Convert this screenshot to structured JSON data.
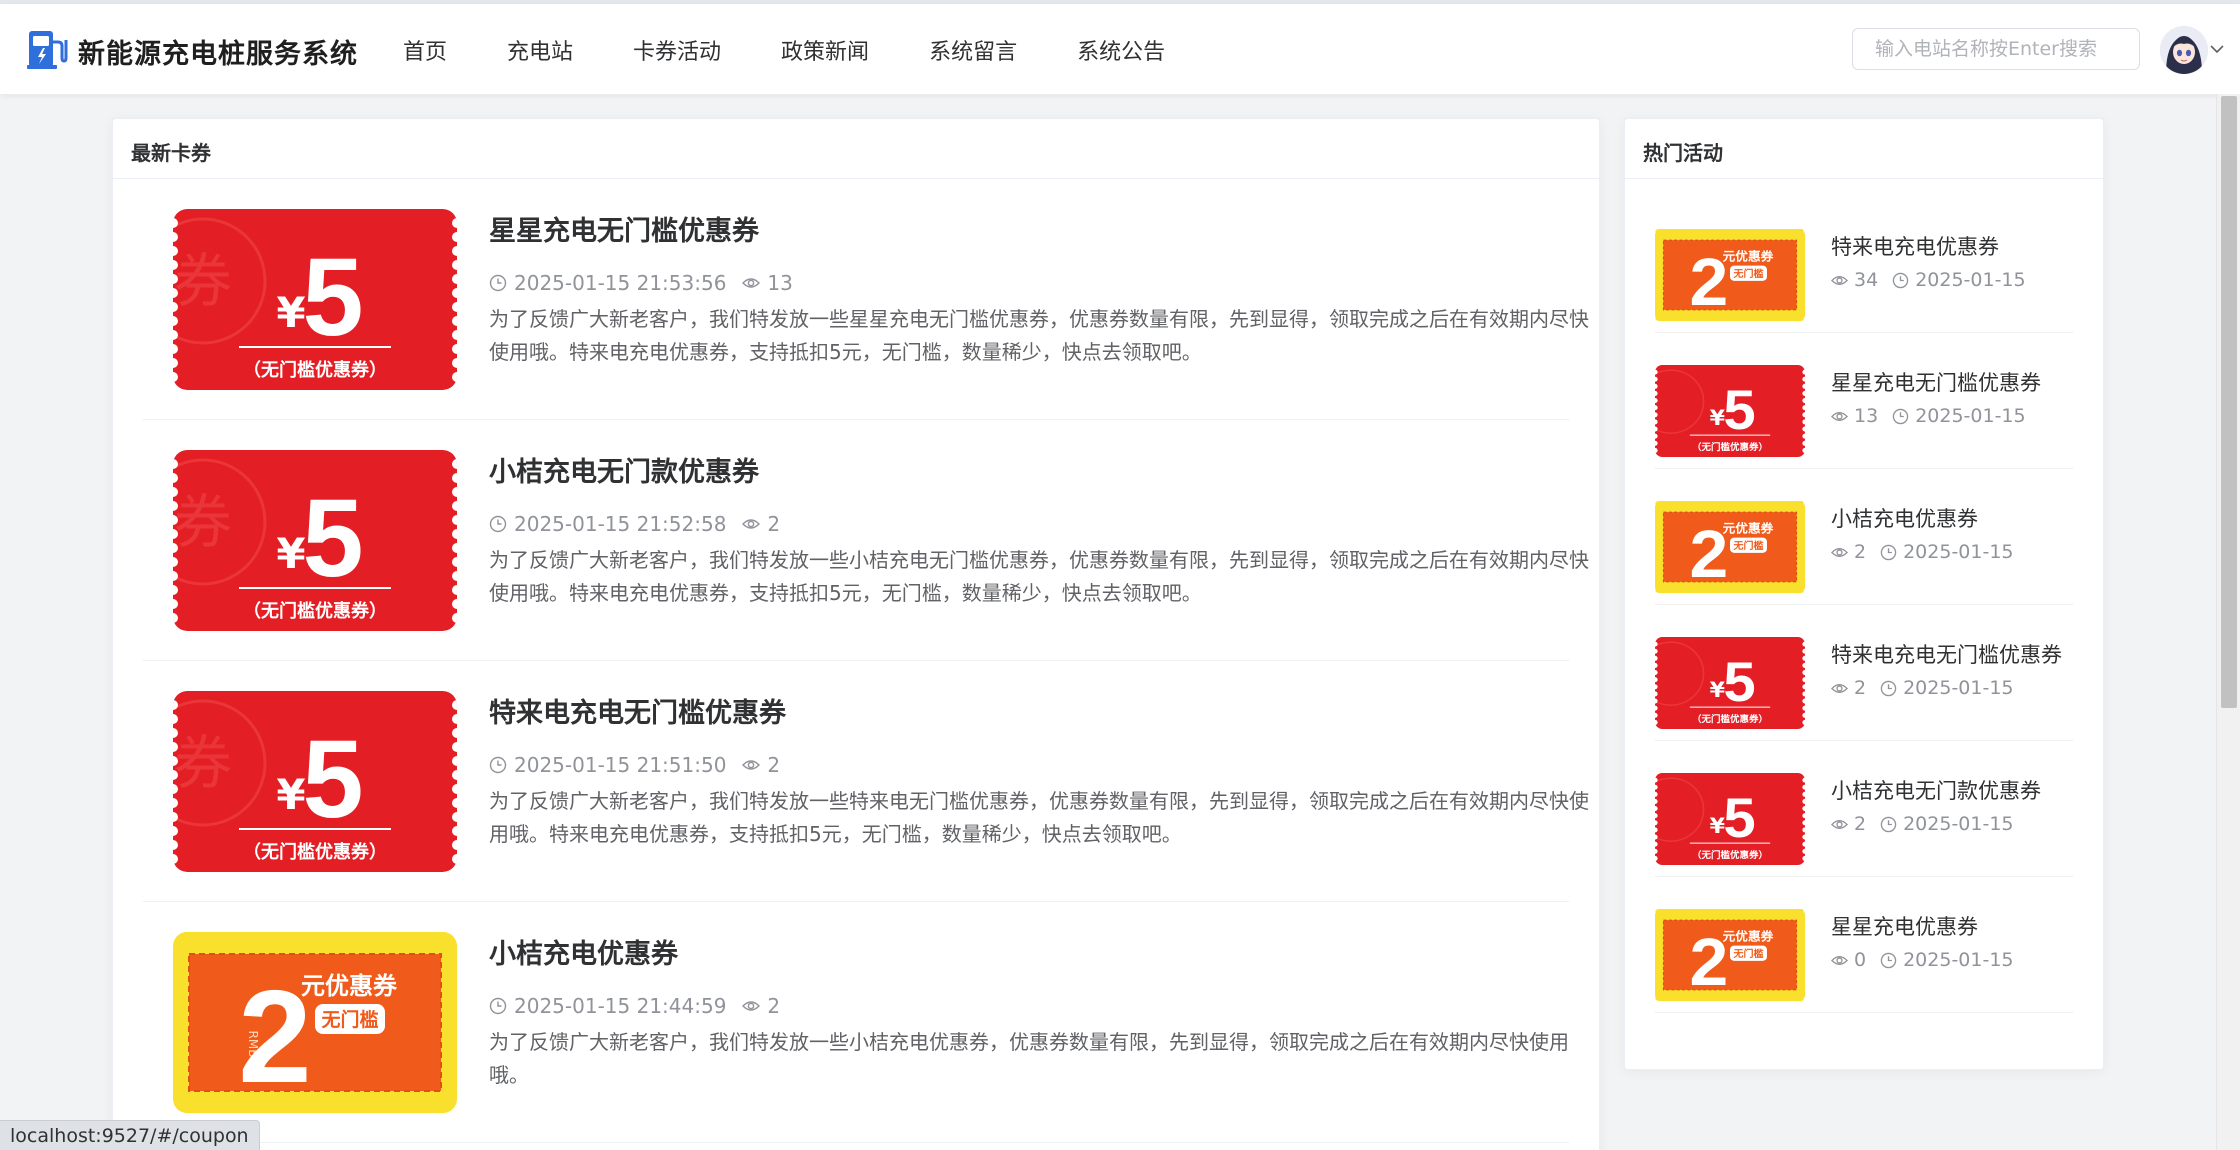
{
  "header": {
    "brand": "新能源充电桩服务系统",
    "nav": [
      "首页",
      "充电站",
      "卡券活动",
      "政策新闻",
      "系统留言",
      "系统公告"
    ],
    "search_placeholder": "输入电站名称按Enter搜索"
  },
  "main": {
    "title": "最新卡券",
    "coupons": [
      {
        "title": "星星充电无门槛优惠券",
        "datetime": "2025-01-15 21:53:56",
        "views": "13",
        "description": "为了反馈广大新老客户，我们特发放一些星星充电无门槛优惠券，优惠券数量有限，先到显得，领取完成之后在有效期内尽快使用哦。特来电充电优惠券，支持抵扣5元，无门槛，数量稀少，快点去领取吧。",
        "thumb": {
          "type": "red",
          "amount": "5",
          "currency": "¥",
          "caption": "（无门槛优惠券）",
          "watermark": "券"
        }
      },
      {
        "title": "小桔充电无门款优惠券",
        "datetime": "2025-01-15 21:52:58",
        "views": "2",
        "description": "为了反馈广大新老客户，我们特发放一些小桔充电无门槛优惠券，优惠券数量有限，先到显得，领取完成之后在有效期内尽快使用哦。特来电充电优惠券，支持抵扣5元，无门槛，数量稀少，快点去领取吧。",
        "thumb": {
          "type": "red",
          "amount": "5",
          "currency": "¥",
          "caption": "（无门槛优惠券）",
          "watermark": "券"
        }
      },
      {
        "title": "特来电充电无门槛优惠券",
        "datetime": "2025-01-15 21:51:50",
        "views": "2",
        "description": "为了反馈广大新老客户，我们特发放一些特来电无门槛优惠券，优惠券数量有限，先到显得，领取完成之后在有效期内尽快使用哦。特来电充电优惠券，支持抵扣5元，无门槛，数量稀少，快点去领取吧。",
        "thumb": {
          "type": "red",
          "amount": "5",
          "currency": "¥",
          "caption": "（无门槛优惠券）",
          "watermark": "券"
        }
      },
      {
        "title": "小桔充电优惠券",
        "datetime": "2025-01-15 21:44:59",
        "views": "2",
        "description": "为了反馈广大新老客户，我们特发放一些小桔充电优惠券，优惠券数量有限，先到显得，领取完成之后在有效期内尽快使用哦。",
        "thumb": {
          "type": "yellow",
          "amount": "2",
          "label": "元优惠券",
          "badge": "无门槛",
          "rmb": "RMB"
        }
      }
    ]
  },
  "side": {
    "title": "热门活动",
    "items": [
      {
        "title": "特来电充电优惠券",
        "views": "34",
        "date": "2025-01-15",
        "thumb": {
          "type": "yellow",
          "amount": "2",
          "label": "元优惠券",
          "badge": "无门槛"
        }
      },
      {
        "title": "星星充电无门槛优惠券",
        "views": "13",
        "date": "2025-01-15",
        "thumb": {
          "type": "red",
          "amount": "5",
          "currency": "¥",
          "caption": "（无门槛优惠券）"
        }
      },
      {
        "title": "小桔充电优惠券",
        "views": "2",
        "date": "2025-01-15",
        "thumb": {
          "type": "yellow",
          "amount": "2",
          "label": "元优惠券",
          "badge": "无门槛"
        }
      },
      {
        "title": "特来电充电无门槛优惠券",
        "views": "2",
        "date": "2025-01-15",
        "thumb": {
          "type": "red",
          "amount": "5",
          "currency": "¥",
          "caption": "（无门槛优惠券）"
        }
      },
      {
        "title": "小桔充电无门款优惠券",
        "views": "2",
        "date": "2025-01-15",
        "thumb": {
          "type": "red",
          "amount": "5",
          "currency": "¥",
          "caption": "（无门槛优惠券）"
        }
      },
      {
        "title": "星星充电优惠券",
        "views": "0",
        "date": "2025-01-15",
        "thumb": {
          "type": "yellow",
          "amount": "2",
          "label": "元优惠券",
          "badge": "无门槛"
        }
      }
    ]
  },
  "statusbar": {
    "url": "localhost:9527/#/coupon"
  },
  "colors": {
    "coupon_red": "#e31e24",
    "coupon_orange": "#f05a1a",
    "coupon_yellow": "#f9e02c",
    "brand_blue": "#2f6fdc"
  }
}
